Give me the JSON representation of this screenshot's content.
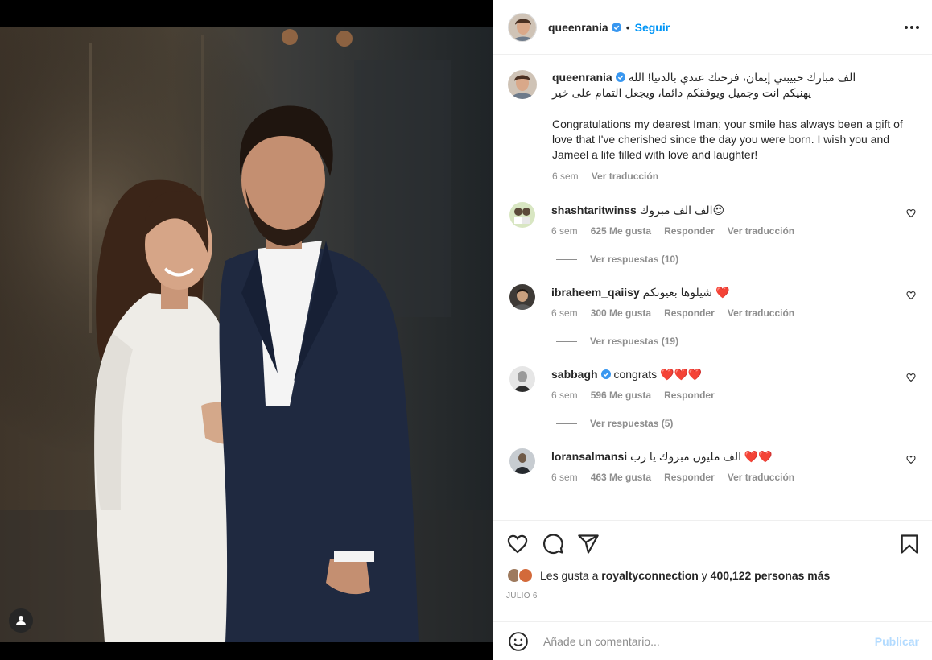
{
  "post": {
    "username": "queenrania",
    "follow_label": "Seguir",
    "dot": "•",
    "caption_username": "queenrania",
    "caption_arabic_1": "الف مبارك حبيبتي إيمان، فرحتك عندي بالدنيا! الله",
    "caption_arabic_2": "يهنيكم انت وجميل ويوفقكم دائما، ويجعل التمام على خير",
    "caption_english": "Congratulations my dearest Iman; your smile has always been a gift of love that I've cherished since the day you were born. I wish you and Jameel a life filled with love and laughter!",
    "caption_time": "6 sem",
    "caption_translate": "Ver traducción"
  },
  "comments": [
    {
      "user": "shashtaritwinss",
      "verified": false,
      "text": "الف الف مبروك",
      "emoji": "😍",
      "time": "6 sem",
      "likes": "625 Me gusta",
      "reply": "Responder",
      "translate": "Ver traducción",
      "replies": "Ver respuestas (10)",
      "avatar_color": "#c9d9a8"
    },
    {
      "user": "ibraheem_qaiisy",
      "verified": false,
      "text": "شيلوها بعيونكم",
      "emoji": "❤️",
      "time": "6 sem",
      "likes": "300 Me gusta",
      "reply": "Responder",
      "translate": "Ver traducción",
      "replies": "Ver respuestas (19)",
      "avatar_color": "#5a4a3c"
    },
    {
      "user": "sabbagh",
      "verified": true,
      "text": "congrats",
      "emoji": "❤️❤️❤️",
      "time": "6 sem",
      "likes": "596 Me gusta",
      "reply": "Responder",
      "translate": "",
      "replies": "Ver respuestas (5)",
      "avatar_color": "#7a7a7a"
    },
    {
      "user": "loransalmansi",
      "verified": false,
      "text": "الف مليون مبروك يا رب",
      "emoji": "❤️❤️",
      "time": "6 sem",
      "likes": "463 Me gusta",
      "reply": "Responder",
      "translate": "Ver traducción",
      "replies": "",
      "avatar_color": "#8a8f94"
    }
  ],
  "likes": {
    "prefix": "Les gusta a",
    "user": "royaltyconnection",
    "joiner": "y",
    "others": "400,122 personas más"
  },
  "date": "JULIO 6",
  "add_comment": {
    "placeholder": "Añade un comentario...",
    "publish": "Publicar"
  },
  "icons": {
    "like": "heart-icon",
    "comment": "comment-icon",
    "share": "share-icon",
    "save": "bookmark-icon",
    "emoji": "emoji-icon",
    "tag": "user-tag-icon",
    "more": "more-icon"
  },
  "colors": {
    "accent": "#0095f6",
    "publish_disabled": "#b3dbff",
    "muted": "#8e8e8e",
    "verified": "#3897f0"
  }
}
